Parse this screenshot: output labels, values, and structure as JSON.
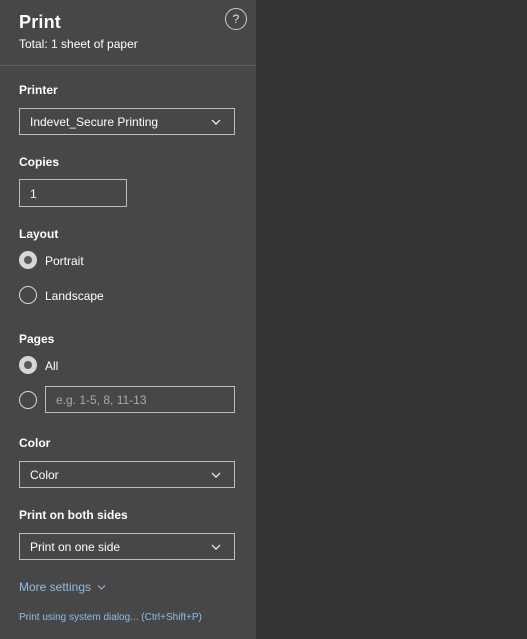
{
  "header": {
    "title": "Print",
    "subtitle": "Total: 1 sheet of paper",
    "help_label": "?"
  },
  "printer": {
    "label": "Printer",
    "value": "Indevet_Secure Printing"
  },
  "copies": {
    "label": "Copies",
    "value": "1"
  },
  "layout": {
    "label": "Layout",
    "options": [
      {
        "label": "Portrait",
        "selected": true
      },
      {
        "label": "Landscape",
        "selected": false
      }
    ]
  },
  "pages": {
    "label": "Pages",
    "all_label": "All",
    "all_selected": true,
    "custom_placeholder": "e.g. 1-5, 8, 11-13"
  },
  "color": {
    "label": "Color",
    "value": "Color"
  },
  "duplex": {
    "label": "Print on both sides",
    "value": "Print on one side"
  },
  "footer": {
    "more_settings": "More settings",
    "system_dialog": "Print using system dialog... (Ctrl+Shift+P)"
  },
  "icons": {
    "help": "question-circle-icon",
    "dropdown": "chevron-down-icon"
  },
  "colors": {
    "panel_bg": "#474747",
    "preview_bg": "#333333",
    "link": "#8fbde6"
  }
}
